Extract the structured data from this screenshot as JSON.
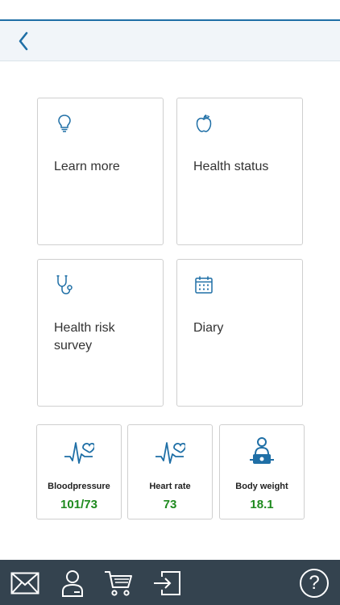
{
  "header": {
    "back_icon": "chevron-left-icon"
  },
  "tiles": [
    {
      "label": "Learn more",
      "icon": "lightbulb-icon"
    },
    {
      "label": "Health status",
      "icon": "apple-icon"
    },
    {
      "label": "Health risk survey",
      "icon": "stethoscope-icon"
    },
    {
      "label": "Diary",
      "icon": "calendar-icon"
    }
  ],
  "metrics": [
    {
      "label": "Bloodpressure",
      "value": "101/73",
      "icon": "heart-pulse-icon"
    },
    {
      "label": "Heart rate",
      "value": "73",
      "icon": "heart-pulse-icon"
    },
    {
      "label": "Body weight",
      "value": "18.1",
      "icon": "person-scale-icon"
    }
  ],
  "tabbar": {
    "items": [
      "mail-icon",
      "profile-icon",
      "cart-icon",
      "logout-icon",
      "help-icon"
    ],
    "help_label": "?"
  },
  "colors": {
    "accent": "#1f6fa6",
    "value_green": "#1e8a1e",
    "tabbar_bg": "#34434f"
  }
}
